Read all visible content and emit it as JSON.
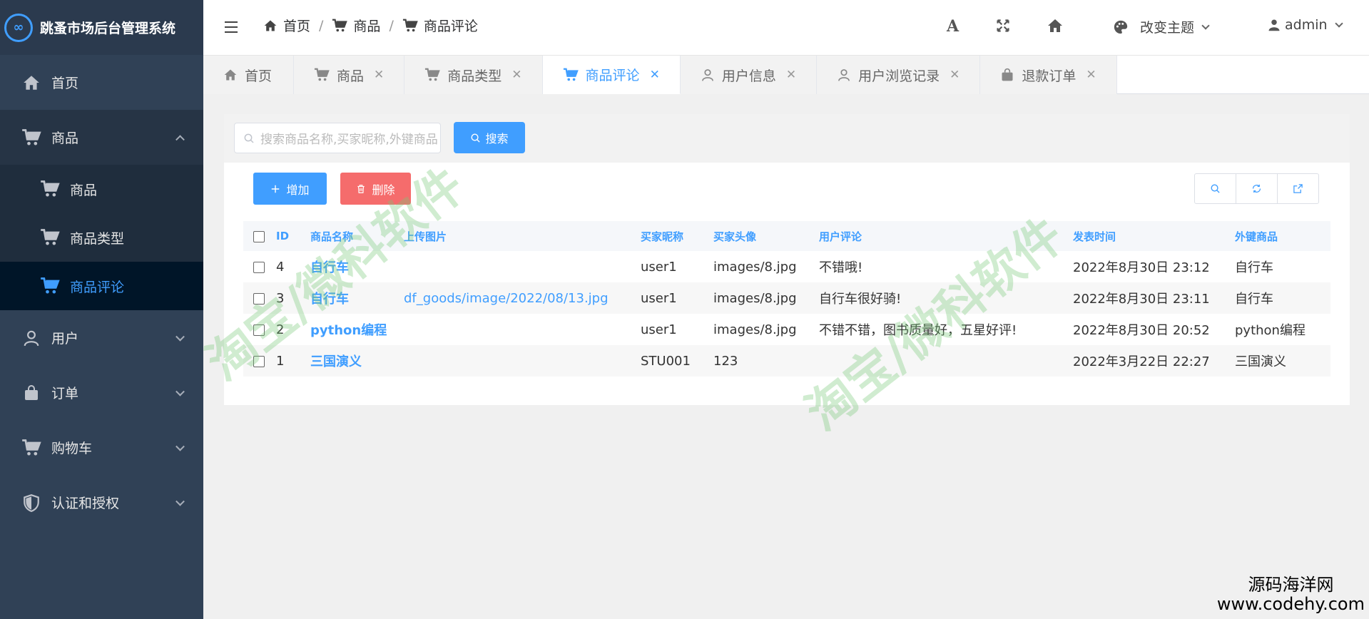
{
  "app": {
    "title": "跳蚤市场后台管理系统",
    "logo_glyph": "∞"
  },
  "sidebar": {
    "items": [
      {
        "label": "首页",
        "icon": "home-icon"
      },
      {
        "label": "商品",
        "icon": "cart-icon",
        "expanded": true,
        "children": [
          {
            "label": "商品",
            "icon": "cart-icon"
          },
          {
            "label": "商品类型",
            "icon": "cart-icon"
          },
          {
            "label": "商品评论",
            "icon": "cart-icon",
            "active": true
          }
        ]
      },
      {
        "label": "用户",
        "icon": "user-icon"
      },
      {
        "label": "订单",
        "icon": "bag-icon"
      },
      {
        "label": "购物车",
        "icon": "cart-icon"
      },
      {
        "label": "认证和授权",
        "icon": "shield-icon"
      }
    ]
  },
  "header": {
    "breadcrumb": [
      "首页",
      "商品",
      "商品评论"
    ],
    "breadcrumb_sep": "/",
    "font_icon_glyph": "A",
    "theme_label": "改变主题",
    "user_name": "admin"
  },
  "tabs": [
    {
      "label": "首页",
      "closable": false
    },
    {
      "label": "商品",
      "closable": true
    },
    {
      "label": "商品类型",
      "closable": true
    },
    {
      "label": "商品评论",
      "closable": true,
      "active": true
    },
    {
      "label": "用户信息",
      "closable": true
    },
    {
      "label": "用户浏览记录",
      "closable": true
    },
    {
      "label": "退款订单",
      "closable": true
    }
  ],
  "tab_close_glyph": "✕",
  "toolbar": {
    "search_placeholder": "搜索商品名称,买家昵称,外键商品",
    "search_label": "搜索",
    "add_label": "增加",
    "delete_label": "删除"
  },
  "table": {
    "headers": [
      "ID",
      "商品名称",
      "上传图片",
      "买家昵称",
      "买家头像",
      "用户评论",
      "发表时间",
      "外键商品"
    ],
    "rows": [
      {
        "id": "4",
        "name": "自行车",
        "image": "",
        "nick": "user1",
        "avatar": "images/8.jpg",
        "comment": "不错哦!",
        "time": "2022年8月30日 23:12",
        "goods": "自行车"
      },
      {
        "id": "3",
        "name": "自行车",
        "image": "df_goods/image/2022/08/13.jpg",
        "nick": "user1",
        "avatar": "images/8.jpg",
        "comment": "自行车很好骑!",
        "time": "2022年8月30日 23:11",
        "goods": "自行车"
      },
      {
        "id": "2",
        "name": "python编程",
        "image": "",
        "nick": "user1",
        "avatar": "images/8.jpg",
        "comment": "不错不错，图书质量好，五星好评!",
        "time": "2022年8月30日 20:52",
        "goods": "python编程"
      },
      {
        "id": "1",
        "name": "三国演义",
        "image": "",
        "nick": "STU001",
        "avatar": "123",
        "comment": "",
        "time": "2022年3月22日 22:27",
        "goods": "三国演义"
      }
    ]
  },
  "watermark": "淘宝/微科软件",
  "corner_brand": {
    "line1": "源码海洋网",
    "line2": "www.codehy.com"
  },
  "colors": {
    "accent": "#409eff",
    "danger": "#f56c6c",
    "sidebar": "#304156"
  }
}
